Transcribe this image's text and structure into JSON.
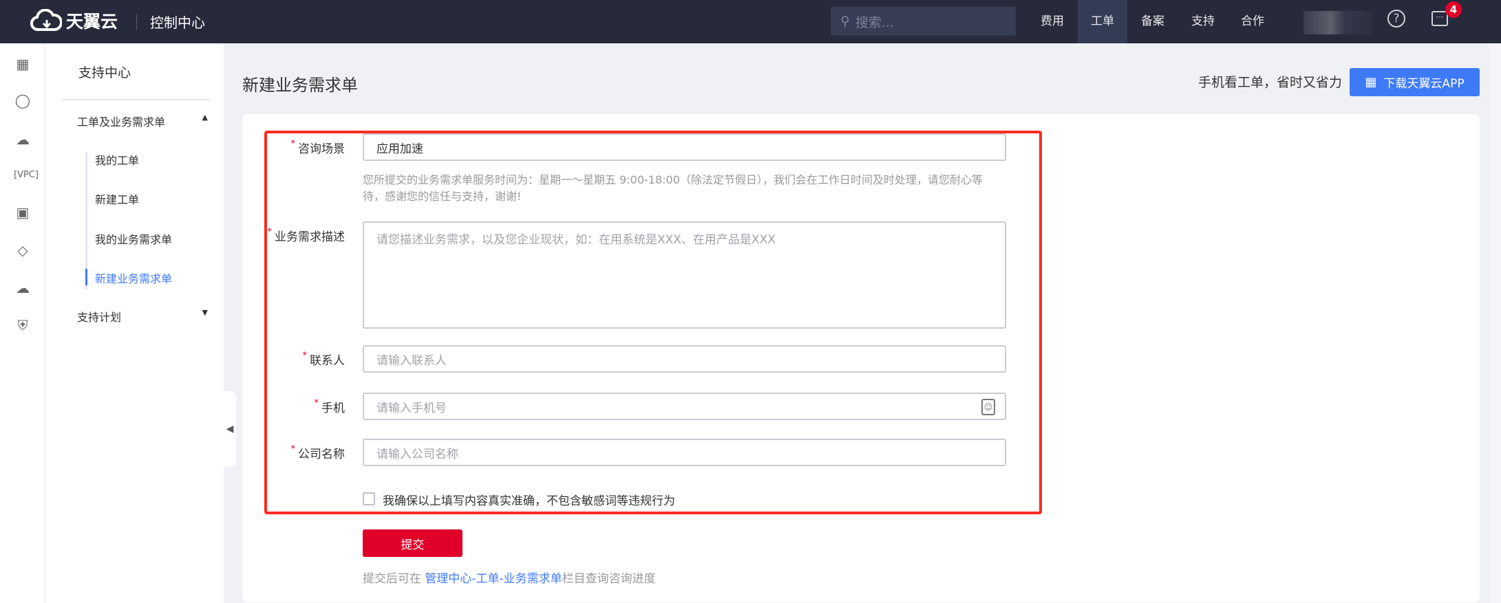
{
  "header": {
    "brand": "天翼云",
    "console": "控制中心",
    "search_placeholder": "搜索...",
    "nav": [
      "费用",
      "工单",
      "备案",
      "支持",
      "合作"
    ],
    "active_nav": "工单",
    "message_count": "4"
  },
  "rail_icons": [
    "grid-icon",
    "network-icon",
    "cloud-server-icon",
    "vpc-icon",
    "storage-icon",
    "scan-icon",
    "cloud-upload-icon",
    "shield-icon"
  ],
  "sidebar": {
    "title": "支持中心",
    "group1": "工单及业务需求单",
    "items": [
      "我的工单",
      "新建工单",
      "我的业务需求单",
      "新建业务需求单"
    ],
    "active_item": "新建业务需求单",
    "group2": "支持计划"
  },
  "page": {
    "title": "新建业务需求单",
    "promo": "手机看工单，省时又省力",
    "download_button": "下载天翼云APP"
  },
  "form": {
    "scene_label": "咨询场景",
    "scene_value": "应用加速",
    "help_text": "您所提交的业务需求单服务时间为：星期一～星期五 9:00-18:00（除法定节假日），我们会在工作日时间及时处理，请您耐心等待，感谢您的信任与支持，谢谢!",
    "desc_label": "业务需求描述",
    "desc_placeholder": "请您描述业务需求，以及您企业现状，如：在用系统是XXX、在用产品是XXX",
    "contact_label": "联系人",
    "contact_placeholder": "请输入联系人",
    "phone_label": "手机",
    "phone_placeholder": "请输入手机号",
    "company_label": "公司名称",
    "company_placeholder": "请输入公司名称",
    "confirm_label": "我确保以上填写内容真实准确，不包含敏感词等违规行为",
    "submit": "提交",
    "note_prefix": "提交后可在 ",
    "note_link": "管理中心-工单-业务需求单",
    "note_suffix": "栏目查询咨询进度",
    "required_mark": "*"
  },
  "colors": {
    "header": "#272a3a",
    "accent": "#3f7af6",
    "submit": "#e0002a",
    "highlight": "#ff2a1f"
  }
}
